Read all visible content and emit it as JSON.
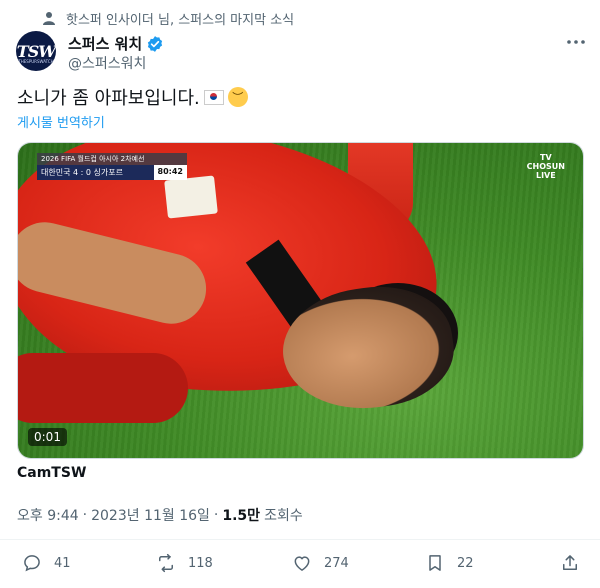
{
  "social_context": {
    "text": "핫스퍼 인사이더 님, 스퍼스의 마지막 소식"
  },
  "author": {
    "display_name": "스퍼스 워치",
    "handle": "@스퍼스워치",
    "avatar_text": "TSW",
    "avatar_sub": "THESPURSWATCH"
  },
  "tweet": {
    "text": "소니가 좀 아파보입니다.",
    "translate_label": "게시물 번역하기",
    "source_label": "CamTSW"
  },
  "media": {
    "scoreboard_title": "2026 FIFA 월드컵 아시아 2차예선",
    "score_text": "대한민국 4 : 0 싱가포르",
    "match_clock": "80:42",
    "broadcaster_line1": "TV",
    "broadcaster_line2": "CHOSUN",
    "broadcaster_line3": "LIVE",
    "timestamp": "0:01"
  },
  "meta": {
    "time": "오후 9:44",
    "date": "2023년 11월 16일",
    "views_count": "1.5만",
    "views_label": "조회수"
  },
  "actions": {
    "replies": "41",
    "reposts": "118",
    "likes": "274",
    "bookmarks": "22"
  },
  "colors": {
    "link": "#1d9bf0",
    "secondary": "#536471",
    "verified": "#1d9bf0"
  }
}
